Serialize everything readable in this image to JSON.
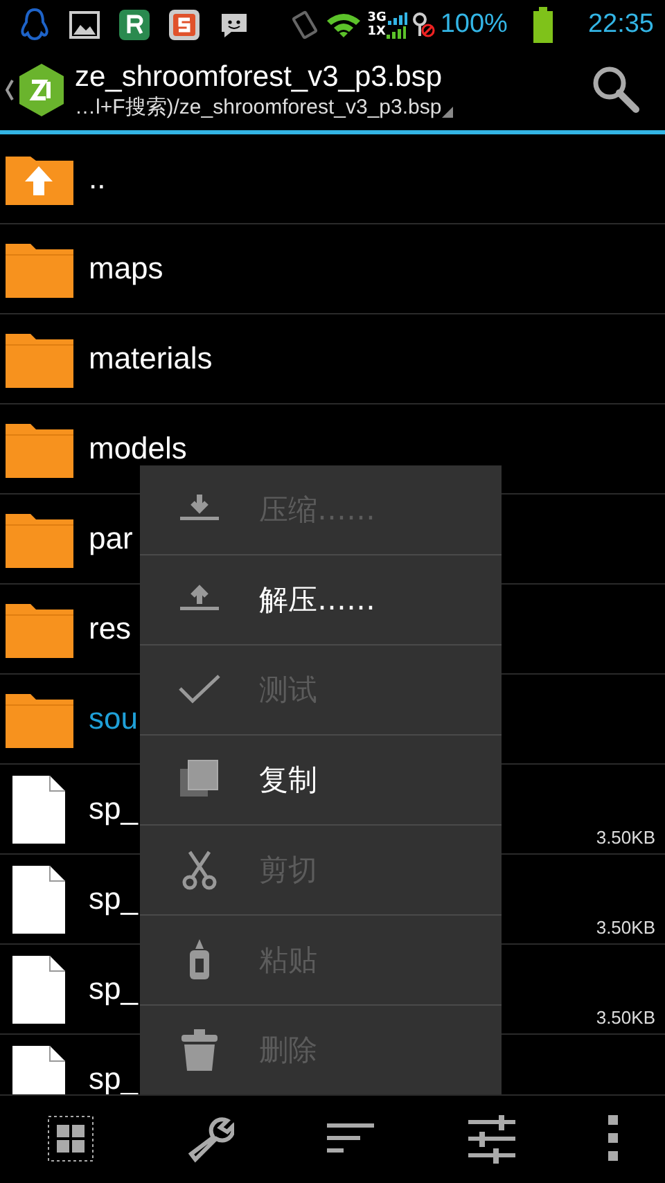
{
  "status_bar": {
    "network": [
      "3G",
      "1X"
    ],
    "battery": "100%",
    "time": "22:35"
  },
  "header": {
    "title": "ze_shroomforest_v3_p3.bsp",
    "path": "…l+F搜索)/ze_shroomforest_v3_p3.bsp"
  },
  "files": [
    {
      "kind": "up",
      "name": "..",
      "selected": false
    },
    {
      "kind": "folder",
      "name": "maps",
      "selected": false
    },
    {
      "kind": "folder",
      "name": "materials",
      "selected": false
    },
    {
      "kind": "folder",
      "name": "models",
      "selected": false
    },
    {
      "kind": "folder",
      "name": "par",
      "selected": false
    },
    {
      "kind": "folder",
      "name": "res",
      "selected": false
    },
    {
      "kind": "folder",
      "name": "sou",
      "selected": true
    },
    {
      "kind": "file",
      "name": "sp_",
      "size": "3.50KB",
      "selected": false
    },
    {
      "kind": "file",
      "name": "sp_",
      "size": "3.50KB",
      "selected": false
    },
    {
      "kind": "file",
      "name": "sp_",
      "size": "3.50KB",
      "selected": false
    },
    {
      "kind": "file",
      "name": "sp_",
      "selected": false
    }
  ],
  "context_menu": [
    {
      "kind": "compress",
      "label": "压缩……",
      "disabled": true
    },
    {
      "kind": "extract",
      "label": "解压……",
      "disabled": false
    },
    {
      "kind": "test",
      "label": "测试",
      "disabled": true
    },
    {
      "kind": "copy",
      "label": "复制",
      "disabled": false
    },
    {
      "kind": "cut",
      "label": "剪切",
      "disabled": true
    },
    {
      "kind": "paste",
      "label": "粘贴",
      "disabled": true
    },
    {
      "kind": "delete",
      "label": "删除",
      "disabled": true
    }
  ],
  "toolbar": [
    {
      "kind": "select"
    },
    {
      "kind": "tools"
    },
    {
      "kind": "sort"
    },
    {
      "kind": "filter"
    },
    {
      "kind": "more"
    }
  ]
}
